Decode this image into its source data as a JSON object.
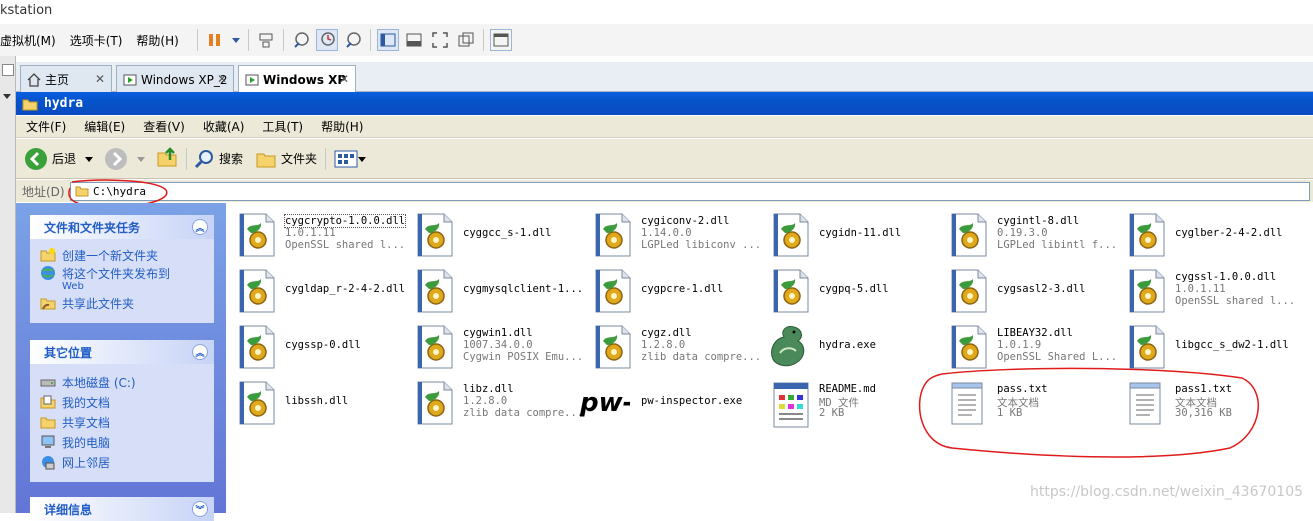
{
  "host": {
    "title": "kstation",
    "menu": [
      "虚拟机(M)",
      "选项卡(T)",
      "帮助(H)"
    ]
  },
  "tabs": [
    {
      "label": "主页",
      "icon": "home-icon"
    },
    {
      "label": "Windows XP_2",
      "icon": "vm-icon"
    },
    {
      "label": "Windows XP",
      "icon": "vm-icon",
      "active": true
    }
  ],
  "window": {
    "title": "hydra",
    "menu": [
      "文件(F)",
      "编辑(E)",
      "查看(V)",
      "收藏(A)",
      "工具(T)",
      "帮助(H)"
    ],
    "toolbar": {
      "back": "后退",
      "search": "搜索",
      "folders": "文件夹"
    },
    "address": {
      "label": "地址(D)",
      "value": "C:\\hydra"
    }
  },
  "taskpane": {
    "tasks": {
      "title": "文件和文件夹任务",
      "items": [
        "创建一个新文件夹",
        "将这个文件夹发布到",
        "Web",
        "共享此文件夹"
      ]
    },
    "places": {
      "title": "其它位置",
      "items": [
        "本地磁盘 (C:)",
        "我的文档",
        "共享文档",
        "我的电脑",
        "网上邻居"
      ]
    },
    "details": {
      "title": "详细信息"
    }
  },
  "files": [
    {
      "name": "cygcrypto-1.0.0.dll",
      "line2": "1.0.1.11",
      "line3": "OpenSSL shared l...",
      "type": "dll"
    },
    {
      "name": "cyggcc_s-1.dll",
      "type": "dll"
    },
    {
      "name": "cygiconv-2.dll",
      "line2": "1.14.0.0",
      "line3": "LGPLed libiconv ...",
      "type": "dll"
    },
    {
      "name": "cygidn-11.dll",
      "type": "dll"
    },
    {
      "name": "cygintl-8.dll",
      "line2": "0.19.3.0",
      "line3": "LGPLed libintl f...",
      "type": "dll"
    },
    {
      "name": "cyglber-2-4-2.dll",
      "type": "dll"
    },
    {
      "name": "cygldap_r-2-4-2.dll",
      "type": "dll"
    },
    {
      "name": "cygmysqlclient-1...",
      "type": "dll"
    },
    {
      "name": "cygpcre-1.dll",
      "type": "dll"
    },
    {
      "name": "cygpq-5.dll",
      "type": "dll"
    },
    {
      "name": "cygsasl2-3.dll",
      "type": "dll"
    },
    {
      "name": "cygssl-1.0.0.dll",
      "line2": "1.0.1.11",
      "line3": "OpenSSL shared l...",
      "type": "dll"
    },
    {
      "name": "cygssp-0.dll",
      "type": "dll"
    },
    {
      "name": "cygwin1.dll",
      "line2": "1007.34.0.0",
      "line3": "Cygwin POSIX Emu...",
      "type": "dll"
    },
    {
      "name": "cygz.dll",
      "line2": "1.2.8.0",
      "line3": "zlib data compre...",
      "type": "dll"
    },
    {
      "name": "hydra.exe",
      "type": "exe"
    },
    {
      "name": "LIBEAY32.dll",
      "line2": "1.0.1.9",
      "line3": "OpenSSL Shared L...",
      "type": "dll"
    },
    {
      "name": "libgcc_s_dw2-1.dll",
      "type": "dll"
    },
    {
      "name": "libssh.dll",
      "type": "dll"
    },
    {
      "name": "libz.dll",
      "line2": "1.2.8.0",
      "line3": "zlib data compre...",
      "type": "dll"
    },
    {
      "name": "pw-inspector.exe",
      "type": "pwi",
      "logo": "pw-i"
    },
    {
      "name": "README.md",
      "line2": "MD 文件",
      "line3": "2 KB",
      "type": "md"
    },
    {
      "name": "pass.txt",
      "line2": "文本文档",
      "line3": "1 KB",
      "type": "txt"
    },
    {
      "name": "pass1.txt",
      "line2": "文本文档",
      "line3": "30,316 KB",
      "type": "txt"
    }
  ],
  "watermark": "https://blog.csdn.net/weixin_43670105",
  "colors": {
    "xp_title": "#0553c9",
    "taskpane": "#6f8fe0",
    "annotation": "#e01b1b"
  }
}
